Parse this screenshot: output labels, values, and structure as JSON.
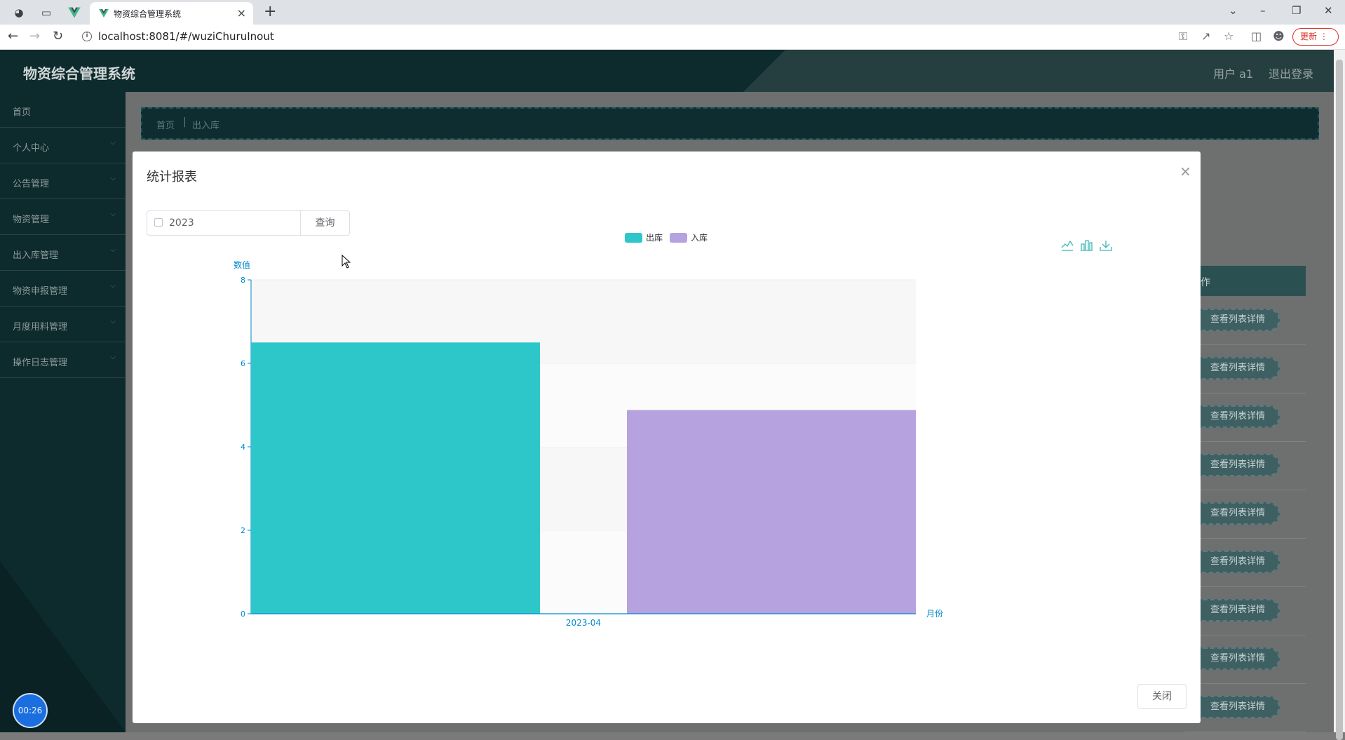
{
  "browser": {
    "tab_title": "物资综合管理系统",
    "url": "localhost:8081/#/wuziChuruInout",
    "update_label": "更新"
  },
  "app": {
    "title": "物资综合管理系统",
    "user_label": "用户 a1",
    "logout_label": "退出登录",
    "breadcrumb": {
      "home": "首页",
      "separator": "|",
      "current": "出入库"
    },
    "sidebar": [
      {
        "label": "首页",
        "has_children": false
      },
      {
        "label": "个人中心",
        "has_children": true
      },
      {
        "label": "公告管理",
        "has_children": true
      },
      {
        "label": "物资管理",
        "has_children": true
      },
      {
        "label": "出入库管理",
        "has_children": true
      },
      {
        "label": "物资申报管理",
        "has_children": true
      },
      {
        "label": "月度用料管理",
        "has_children": true
      },
      {
        "label": "操作日志管理",
        "has_children": true
      }
    ],
    "timer": "00:26",
    "table_header_partial": "作",
    "row_action_label": "查看列表详情",
    "row_count": 9
  },
  "modal": {
    "title": "统计报表",
    "year_value": "2023",
    "query_label": "查询",
    "close_label": "关闭"
  },
  "chart_data": {
    "type": "bar",
    "ylabel": "数值",
    "xlabel": "月份",
    "categories": [
      "2023-04"
    ],
    "series": [
      {
        "name": "出库",
        "values": [
          6.5
        ],
        "color": "#2ec7c9"
      },
      {
        "name": "入库",
        "values": [
          4.88
        ],
        "color": "#b6a2de"
      }
    ],
    "ylim": [
      0,
      8
    ],
    "yticks": [
      0,
      2,
      4,
      6,
      8
    ],
    "legend_position": "top-center",
    "toolbox": [
      "line-chart-icon",
      "bar-chart-icon",
      "download-icon"
    ],
    "grid": true
  }
}
